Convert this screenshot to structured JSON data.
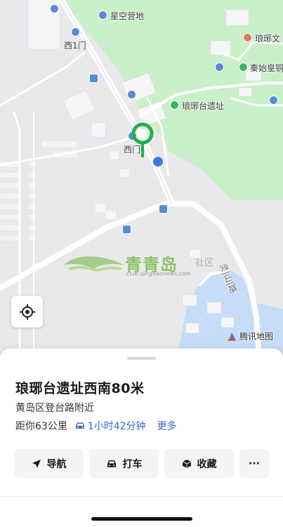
{
  "map": {
    "labels": {
      "camp": "星空营地",
      "west_gate_1": "西1门",
      "culture": "琅琊文",
      "qin": "秦始皇铜",
      "site": "琅琊台遗址",
      "west_gate": "西门",
      "road": "灵|山|路"
    },
    "attribution": "腾讯地图",
    "watermark": {
      "name": "青青岛",
      "tag": "社区",
      "url": "club.qingdaonews.com"
    },
    "colors": {
      "land": "#e9e9ec",
      "park": "#c9f0c9",
      "road": "#ffffff",
      "water": "#c6dcf8",
      "pin": "#22b14c",
      "poi_blue": "#5a8ad8",
      "poi_green": "#3db562"
    }
  },
  "place": {
    "title": "琅琊台遗址西南80米",
    "address": "黄岛区登台路附近",
    "distance": "距你63公里",
    "drive_time": "1小时42分钟",
    "more": "更多"
  },
  "actions": {
    "navigate": "导航",
    "taxi": "打车",
    "favorite": "收藏",
    "more": "···"
  }
}
